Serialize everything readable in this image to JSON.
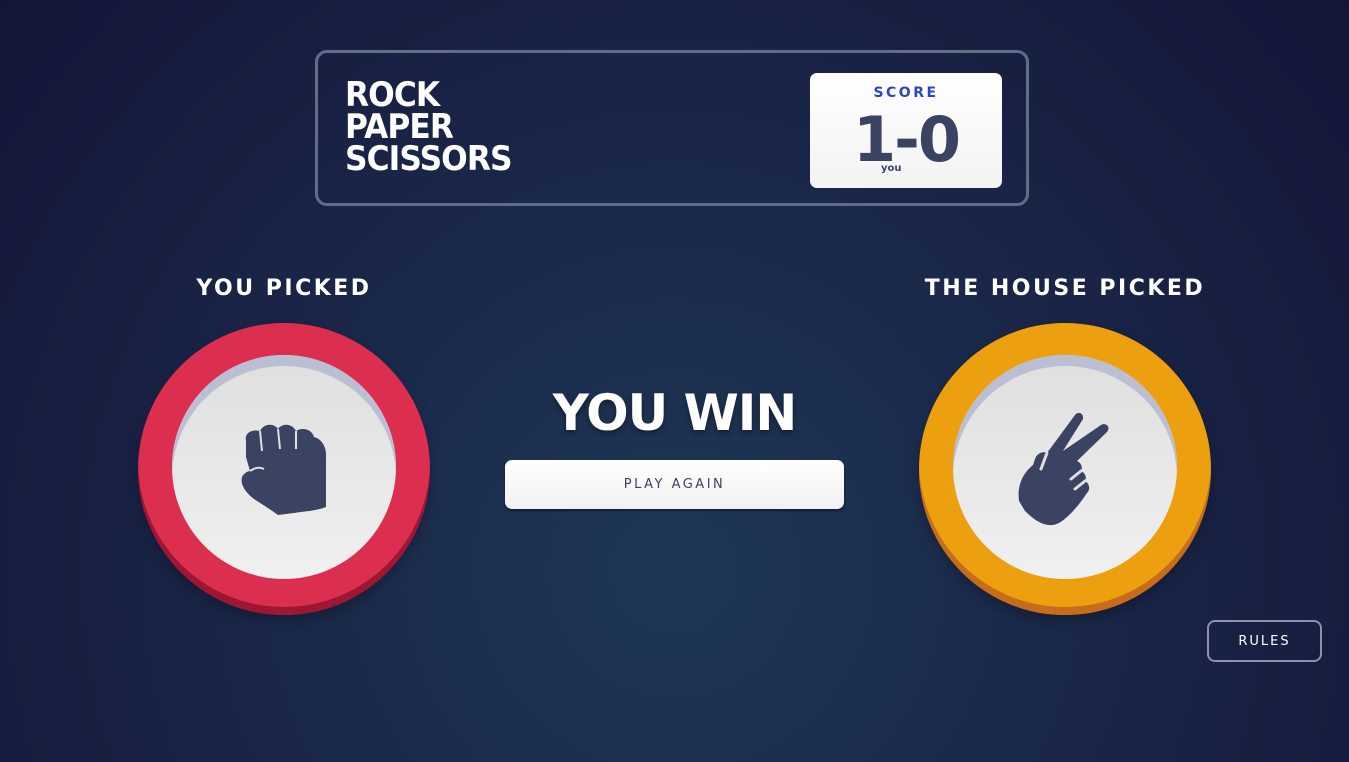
{
  "header": {
    "title_lines": [
      "ROCK",
      "PAPER",
      "SCISSORS"
    ],
    "score": {
      "label": "SCORE",
      "value": "1-0",
      "sub_label": "you"
    }
  },
  "player": {
    "label": "YOU PICKED",
    "choice": "rock",
    "icon": "rock-fist-icon",
    "ring_color": "#dc2e4e"
  },
  "house": {
    "label": "THE HOUSE PICKED",
    "choice": "scissors",
    "icon": "scissors-hand-icon",
    "ring_color": "#eca00f"
  },
  "result": {
    "text": "YOU WIN",
    "play_again_label": "PLAY AGAIN"
  },
  "rules": {
    "label": "RULES"
  },
  "colors": {
    "icon_fill": "#3b4363",
    "score_label": "#2a46c0"
  }
}
